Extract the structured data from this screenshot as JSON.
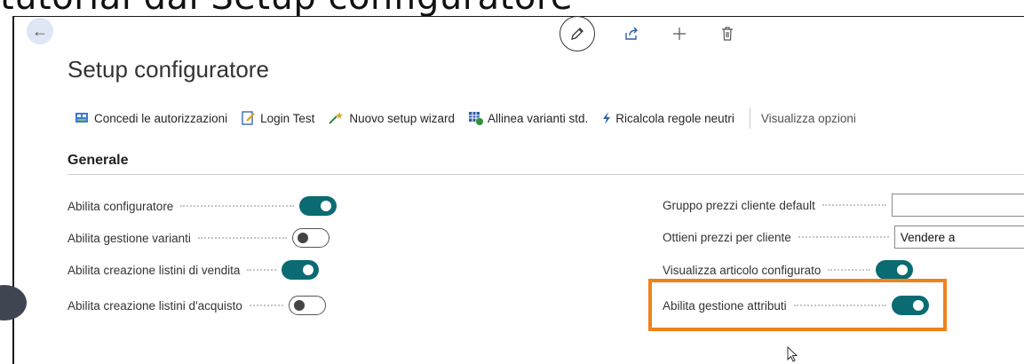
{
  "overlay_caption": "tutorial dal Setup configuratore",
  "page": {
    "title": "Setup configuratore"
  },
  "icons": {
    "back": "back-arrow-icon",
    "edit": "pencil-icon",
    "share": "share-icon",
    "new": "plus-icon",
    "delete": "trash-icon"
  },
  "toolbar": {
    "grant_permissions": "Concedi le autorizzazioni",
    "login_test": "Login Test",
    "new_setup_wizard": "Nuovo setup wizard",
    "align_variants": "Allinea varianti std.",
    "recalc_rules": "Ricalcola regole neutri",
    "view_options": "Visualizza opzioni"
  },
  "section": {
    "title": "Generale"
  },
  "fields_left": [
    {
      "label": "Abilita configuratore",
      "value": true
    },
    {
      "label": "Abilita gestione varianti",
      "value": false
    },
    {
      "label": "Abilita creazione listini di vendita",
      "value": true
    },
    {
      "label": "Abilita creazione listini d'acquisto",
      "value": false
    }
  ],
  "fields_right": [
    {
      "label": "Gruppo prezzi cliente default",
      "value": ""
    },
    {
      "label": "Ottieni prezzi per cliente",
      "value": "Vendere a"
    },
    {
      "label": "Visualizza articolo configurato",
      "value": true
    },
    {
      "label": "Abilita gestione attributi",
      "value": true
    }
  ],
  "colors": {
    "accent": "#0b6b72",
    "highlight": "#f0821a",
    "back_button_bg": "#dfe6f5"
  }
}
